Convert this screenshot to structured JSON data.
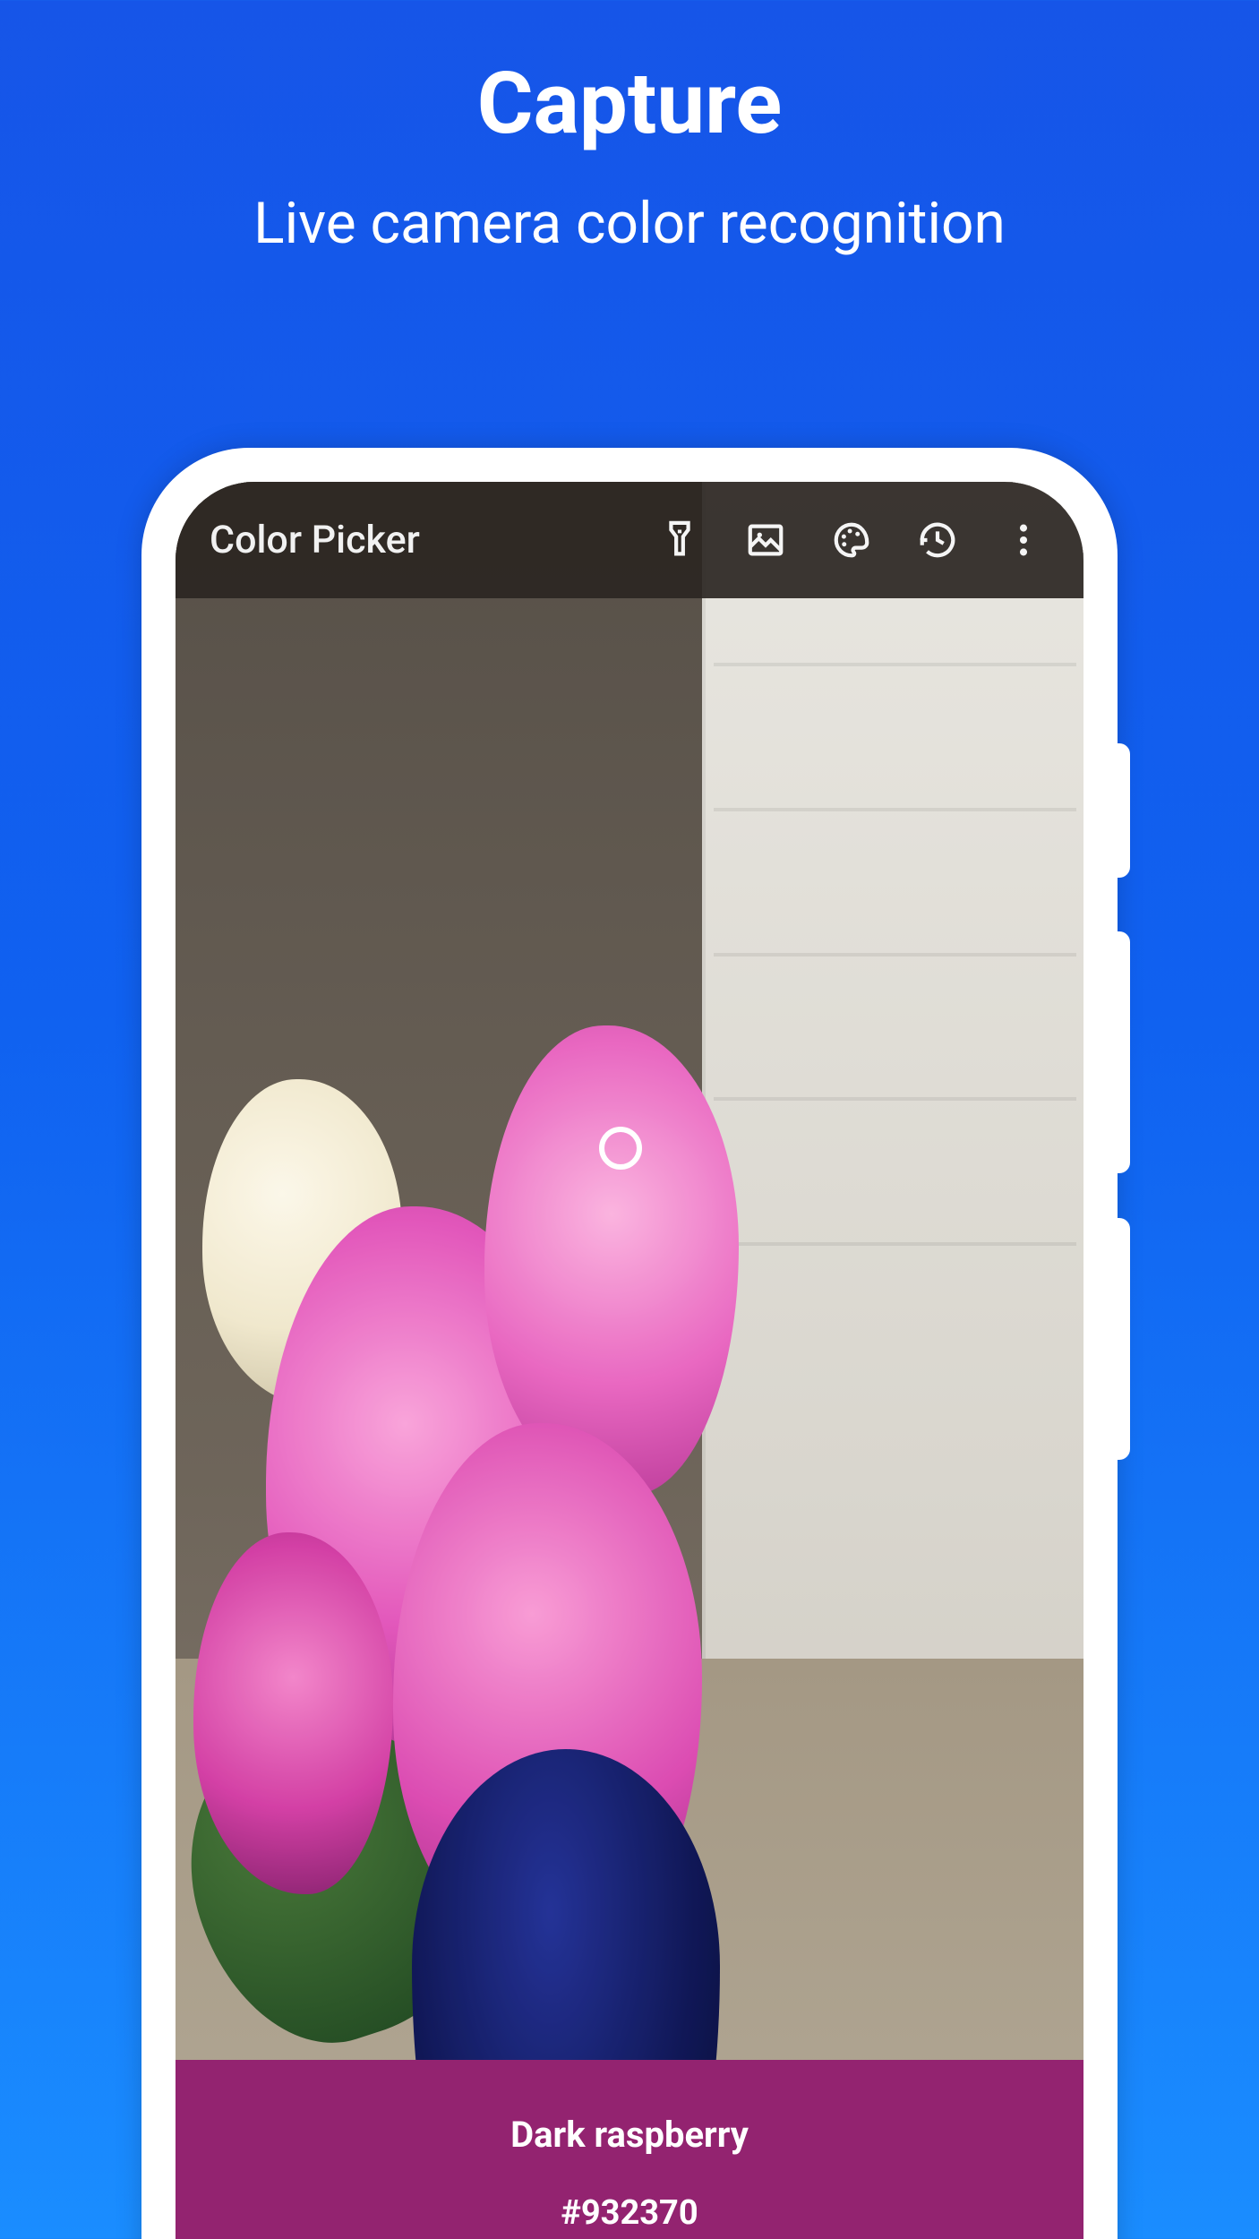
{
  "hero": {
    "title": "Capture",
    "subtitle": "Live camera color recognition"
  },
  "appbar": {
    "title": "Color Picker",
    "icons": {
      "flashlight": "flashlight-icon",
      "gallery": "gallery-icon",
      "palette": "palette-icon",
      "history": "history-icon",
      "more": "more-icon"
    }
  },
  "result": {
    "name": "Dark raspberry",
    "hex": "#932370",
    "bg": "#932370"
  }
}
